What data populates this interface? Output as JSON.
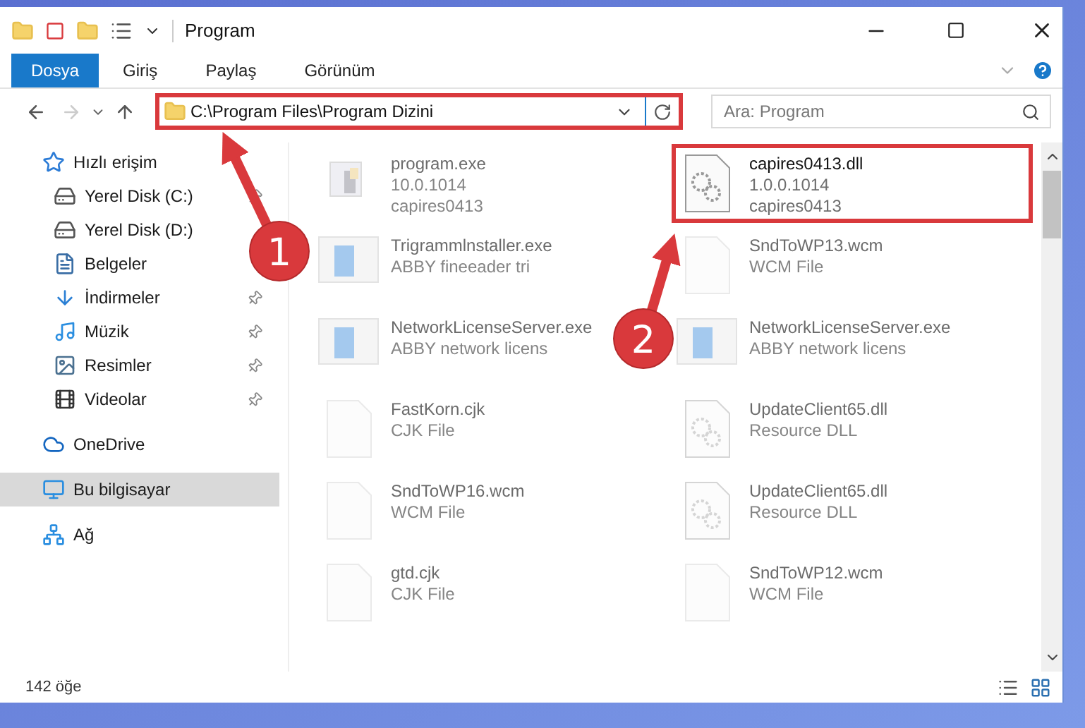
{
  "window": {
    "title": "Program"
  },
  "ribbon_tabs": [
    {
      "label": "Dosya",
      "selected": true
    },
    {
      "label": "Giriş",
      "selected": false
    },
    {
      "label": "Paylaş",
      "selected": false
    },
    {
      "label": "Görünüm",
      "selected": false
    }
  ],
  "address": {
    "path": "C:\\Program Files\\Program Dizini",
    "highlighted": true
  },
  "search": {
    "placeholder": "Ara: Program"
  },
  "sidebar": {
    "items": [
      {
        "label": "Hızlı erişim",
        "kind": "star",
        "pinned": false,
        "selected": false,
        "children": [
          {
            "label": "Yerel Disk (C:)",
            "kind": "drive-c",
            "pinned": true,
            "selected": false
          },
          {
            "label": "Yerel Disk (D:)",
            "kind": "drive",
            "pinned": false,
            "selected": false
          },
          {
            "label": "Belgeler",
            "kind": "docs",
            "pinned": false,
            "selected": false
          },
          {
            "label": "İndirmeler",
            "kind": "download",
            "pinned": true,
            "selected": false
          },
          {
            "label": "Müzik",
            "kind": "music",
            "pinned": true,
            "selected": false
          },
          {
            "label": "Resimler",
            "kind": "pictures",
            "pinned": true,
            "selected": false
          },
          {
            "label": "Videolar",
            "kind": "video",
            "pinned": true,
            "selected": false
          }
        ]
      },
      {
        "label": "OneDrive",
        "kind": "cloud",
        "pinned": false,
        "selected": false
      },
      {
        "label": "Bu bilgisayar",
        "kind": "computer",
        "pinned": false,
        "selected": true
      },
      {
        "label": "Ağ",
        "kind": "network",
        "pinned": false,
        "selected": false
      }
    ]
  },
  "files": [
    {
      "name": "program.exe",
      "lines": [
        "10.0.1014",
        "capires0413"
      ],
      "kind": "app",
      "faded": true,
      "highlighted": false
    },
    {
      "name": "capires0413.dll",
      "lines": [
        "1.0.0.1014",
        "capires0413"
      ],
      "kind": "dll",
      "faded": false,
      "highlighted": true
    },
    {
      "name": "Trigrammlnstaller.exe",
      "lines": [
        "ABBY fineeader tri"
      ],
      "kind": "window",
      "faded": true,
      "highlighted": false
    },
    {
      "name": "SndToWP13.wcm",
      "lines": [
        "WCM File"
      ],
      "kind": "blank",
      "faded": true,
      "highlighted": false
    },
    {
      "name": "NetworkLicenseServer.exe",
      "lines": [
        "ABBY network licens"
      ],
      "kind": "window",
      "faded": true,
      "highlighted": false
    },
    {
      "name": "NetworkLicenseServer.exe",
      "lines": [
        "ABBY network licens"
      ],
      "kind": "window",
      "faded": true,
      "highlighted": false
    },
    {
      "name": "FastKorn.cjk",
      "lines": [
        "CJK File"
      ],
      "kind": "blank",
      "faded": true,
      "highlighted": false
    },
    {
      "name": "UpdateClient65.dll",
      "lines": [
        "Resource DLL"
      ],
      "kind": "dll",
      "faded": true,
      "highlighted": false
    },
    {
      "name": "SndToWP16.wcm",
      "lines": [
        "WCM File"
      ],
      "kind": "blank",
      "faded": true,
      "highlighted": false
    },
    {
      "name": "UpdateClient65.dll",
      "lines": [
        "Resource DLL"
      ],
      "kind": "dll",
      "faded": true,
      "highlighted": false
    },
    {
      "name": "gtd.cjk",
      "lines": [
        "CJK File"
      ],
      "kind": "blank",
      "faded": true,
      "highlighted": false
    },
    {
      "name": "SndToWP12.wcm",
      "lines": [
        "WCM File"
      ],
      "kind": "blank",
      "faded": true,
      "highlighted": false
    }
  ],
  "status_bar": {
    "count": "142 öğe"
  },
  "annotations": [
    {
      "number": "1"
    },
    {
      "number": "2"
    }
  ]
}
